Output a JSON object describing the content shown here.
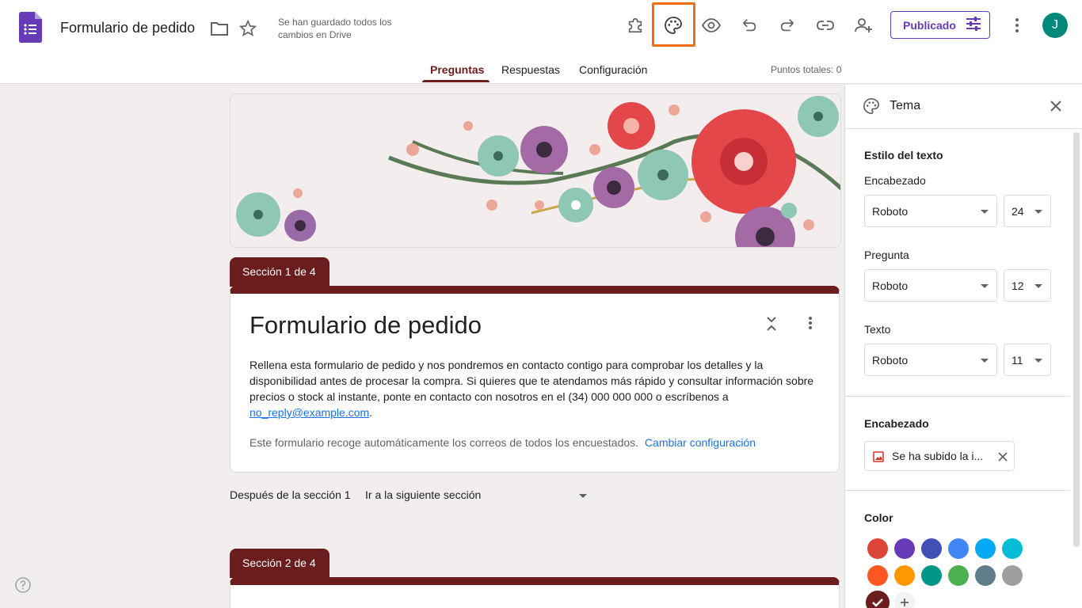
{
  "header": {
    "doc_title": "Formulario de pedido",
    "saved_status": "Se han guardado todos los cambios en Drive",
    "publish_label": "Publicado",
    "avatar_initial": "J",
    "icons": [
      "forms-logo-icon",
      "folder-icon",
      "star-icon",
      "addons-icon",
      "palette-icon",
      "preview-icon",
      "undo-icon",
      "redo-icon",
      "link-icon",
      "add-collaborator-icon",
      "settings-sliders-icon",
      "more-vert-icon"
    ]
  },
  "tabs": [
    {
      "label": "Preguntas",
      "active": true
    },
    {
      "label": "Respuestas",
      "active": false
    },
    {
      "label": "Configuración",
      "active": false
    }
  ],
  "points_total": "Puntos totales: 0",
  "form": {
    "section1_tab": "Sección 1 de 4",
    "title": "Formulario de pedido",
    "description": "Rellena esta formulario de pedido y nos pondremos en contacto contigo para comprobar los detalles y la disponibilidad antes de procesar la compra. Si quieres que te atendamos más rápido y consultar información sobre precios o stock al instante, ponte en contacto con nosotros en el (34) 000 000 000 o escríbenos a ",
    "email": "no_reply@example.com",
    "description_end": ".",
    "collect_note": "Este formulario recoge automáticamente los correos de todos los encuestados.",
    "collect_link": "Cambiar configuración",
    "after_section_label": "Después de la sección 1",
    "after_section_value": "Ir a la siguiente sección",
    "section2_tab": "Sección 2 de 4"
  },
  "theme_panel": {
    "title": "Tema",
    "text_style_heading": "Estilo del texto",
    "rows": [
      {
        "label": "Encabezado",
        "font": "Roboto",
        "size": "24"
      },
      {
        "label": "Pregunta",
        "font": "Roboto",
        "size": "12"
      },
      {
        "label": "Texto",
        "font": "Roboto",
        "size": "11"
      }
    ],
    "header_heading": "Encabezado",
    "header_chip": "Se ha subido la i...",
    "color_heading": "Color",
    "colors": [
      "#db4437",
      "#673ab7",
      "#3f51b5",
      "#4285f4",
      "#03a9f4",
      "#00bcd4",
      "#ff5722",
      "#ff9800",
      "#009688",
      "#4caf50",
      "#607d8b",
      "#9e9e9e",
      "#6b1c1c"
    ],
    "selected_color": "#6b1c1c"
  }
}
